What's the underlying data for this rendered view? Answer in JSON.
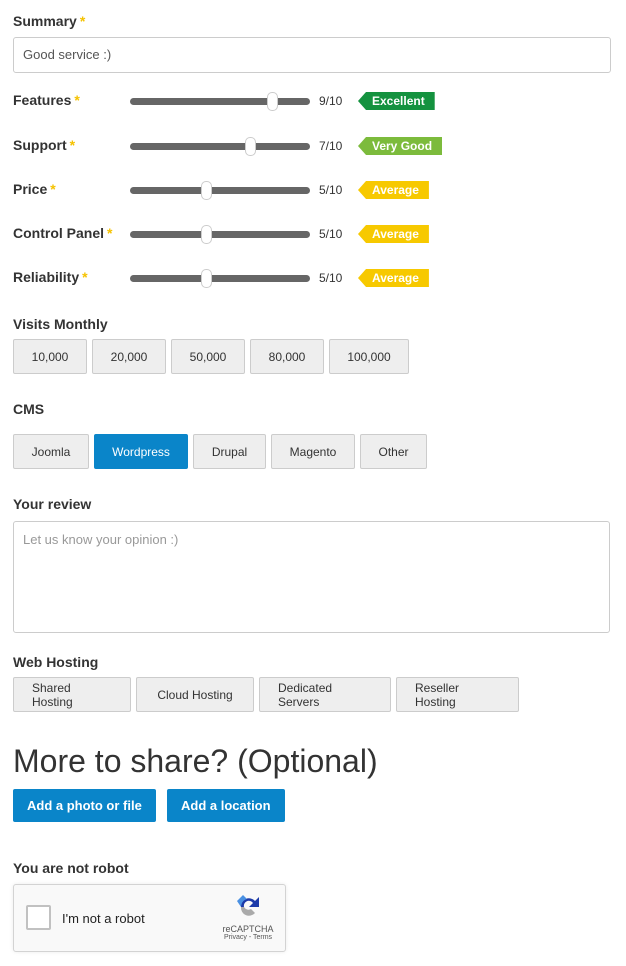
{
  "summary": {
    "label": "Summary",
    "value": "Good service :)"
  },
  "ratings": [
    {
      "label": "Features",
      "value": 9,
      "score": "9/10",
      "badge": "Excellent",
      "color": "#14923f"
    },
    {
      "label": "Support",
      "value": 7,
      "score": "7/10",
      "badge": "Very Good",
      "color": "#7cbb3c"
    },
    {
      "label": "Price",
      "value": 5,
      "score": "5/10",
      "badge": "Average",
      "color": "#f7c900"
    },
    {
      "label": "Control Panel",
      "value": 5,
      "score": "5/10",
      "badge": "Average",
      "color": "#f7c900"
    },
    {
      "label": "Reliability",
      "value": 5,
      "score": "5/10",
      "badge": "Average",
      "color": "#f7c900"
    }
  ],
  "required_mark": "*",
  "visits": {
    "label": "Visits Monthly",
    "options": [
      "10,000",
      "20,000",
      "50,000",
      "80,000",
      "100,000"
    ]
  },
  "cms": {
    "label": "CMS",
    "options": [
      "Joomla",
      "Wordpress",
      "Drupal",
      "Magento",
      "Other"
    ],
    "selected": "Wordpress"
  },
  "review": {
    "label": "Your review",
    "placeholder": "Let us know your opinion :)"
  },
  "hosting": {
    "label": "Web Hosting",
    "options": [
      "Shared Hosting",
      "Cloud Hosting",
      "Dedicated Servers",
      "Reseller Hosting"
    ]
  },
  "more": {
    "title": "More to share? (Optional)",
    "photo_button": "Add a photo or file",
    "location_button": "Add a location"
  },
  "robot": {
    "label": "You are not robot",
    "checkbox_label": "I'm not a robot",
    "brand": "reCAPTCHA",
    "links": "Privacy - Terms"
  }
}
